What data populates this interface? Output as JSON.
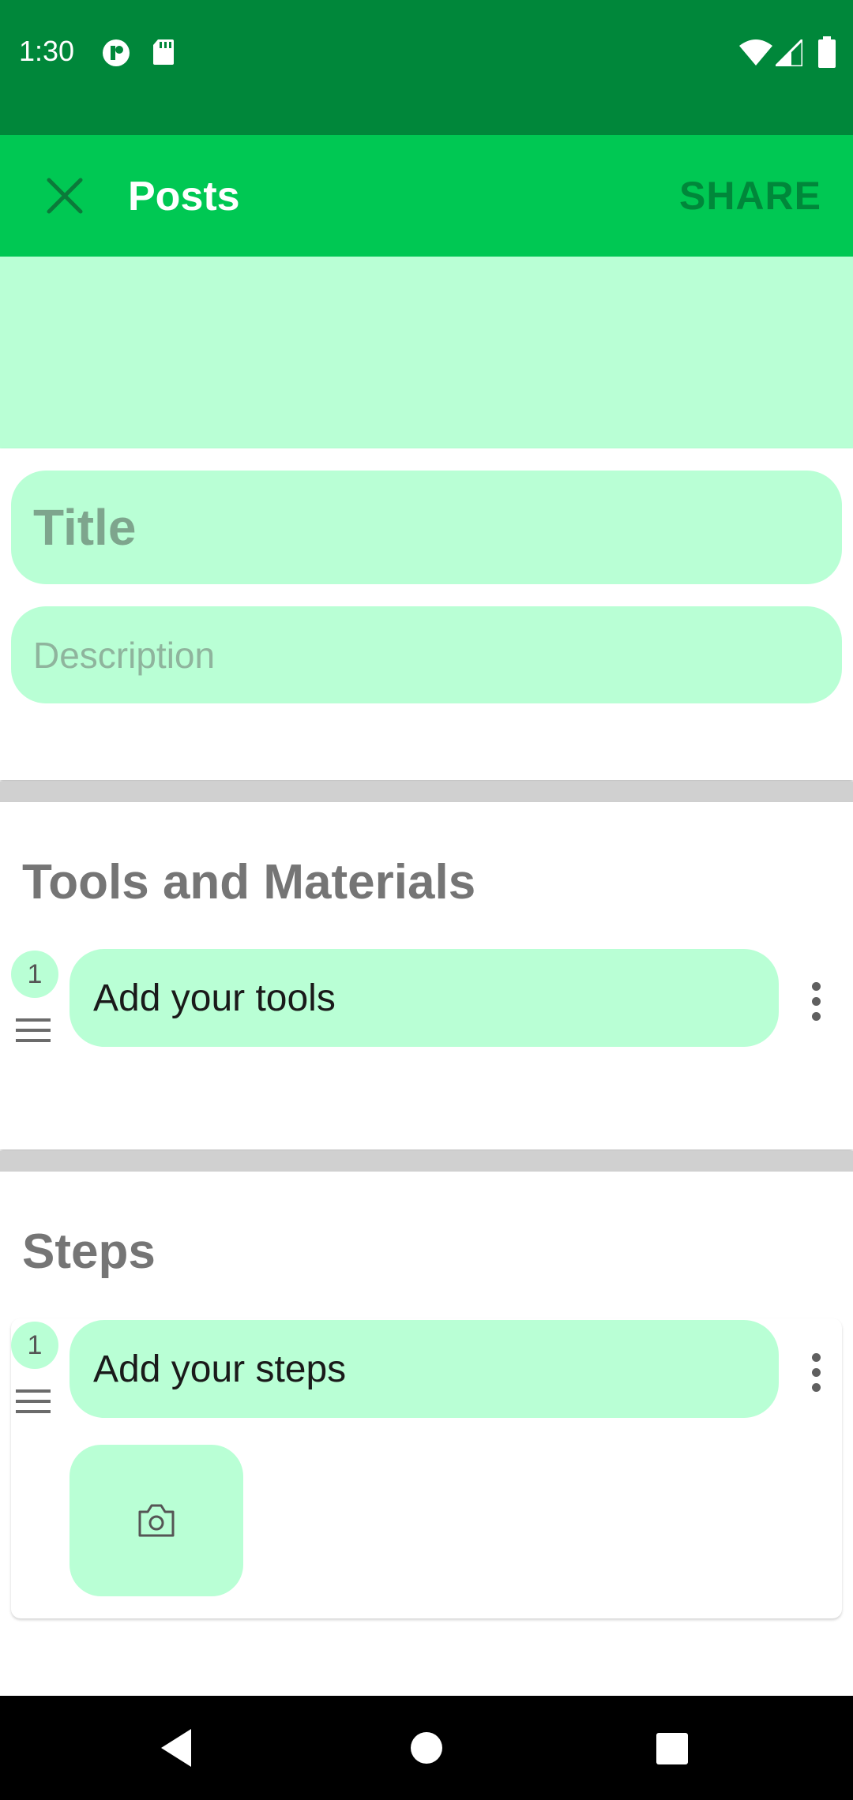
{
  "status_bar": {
    "time": "1:30",
    "left_icons": [
      "app-notification-icon",
      "sd-card-icon"
    ],
    "right_icons": [
      "wifi-icon",
      "signal-icon",
      "battery-icon"
    ]
  },
  "app_bar": {
    "close_icon": "close-icon",
    "title": "Posts",
    "share_label": "SHARE"
  },
  "post": {
    "title_placeholder": "Title",
    "description_placeholder": "Description"
  },
  "tools_section": {
    "heading": "Tools and Materials",
    "items": [
      {
        "number": "1",
        "placeholder": "Add your tools"
      }
    ]
  },
  "steps_section": {
    "heading": "Steps",
    "items": [
      {
        "number": "1",
        "placeholder": "Add your steps",
        "photo_icon": "camera-icon"
      }
    ]
  },
  "nav_bar": {
    "icons": [
      "back-icon",
      "home-icon",
      "recents-icon"
    ]
  },
  "colors": {
    "status_bar": "#00873A",
    "app_bar": "#00C853",
    "accent_light": "#B9FFD5",
    "share_text": "#00873A"
  }
}
